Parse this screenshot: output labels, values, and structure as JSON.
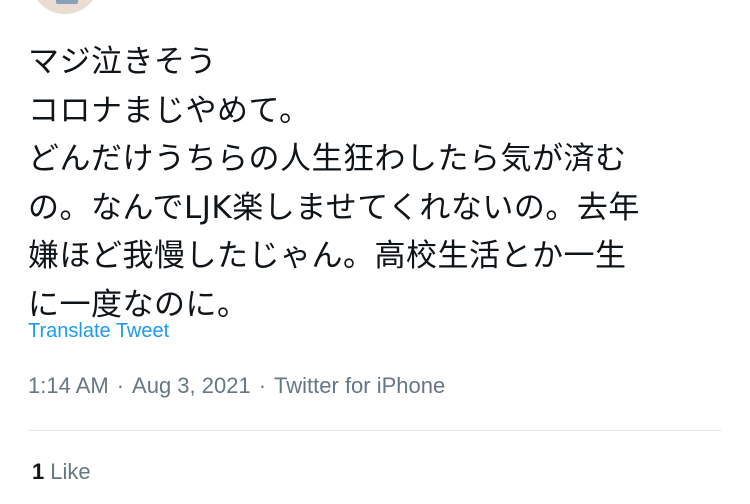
{
  "tweet": {
    "text": "マジ泣きそう\nコロナまじやめて。\nどんだけうちらの人生狂わしたら気が済む\nの。なんでLJK楽しませてくれないの。去年\n嫌ほど我慢したじゃん。高校生活とか一生\nに一度なのに。",
    "translate_label": "Translate Tweet",
    "time": "1:14 AM",
    "date": "Aug 3, 2021",
    "separator": "·",
    "source": "Twitter for iPhone",
    "like_count": "1",
    "like_label": "Like"
  },
  "colors": {
    "link": "#1d9bf0",
    "meta": "#657786",
    "text": "#0f1419",
    "divider": "#e1e8ed"
  },
  "icons": {
    "avatar": "avatar"
  }
}
